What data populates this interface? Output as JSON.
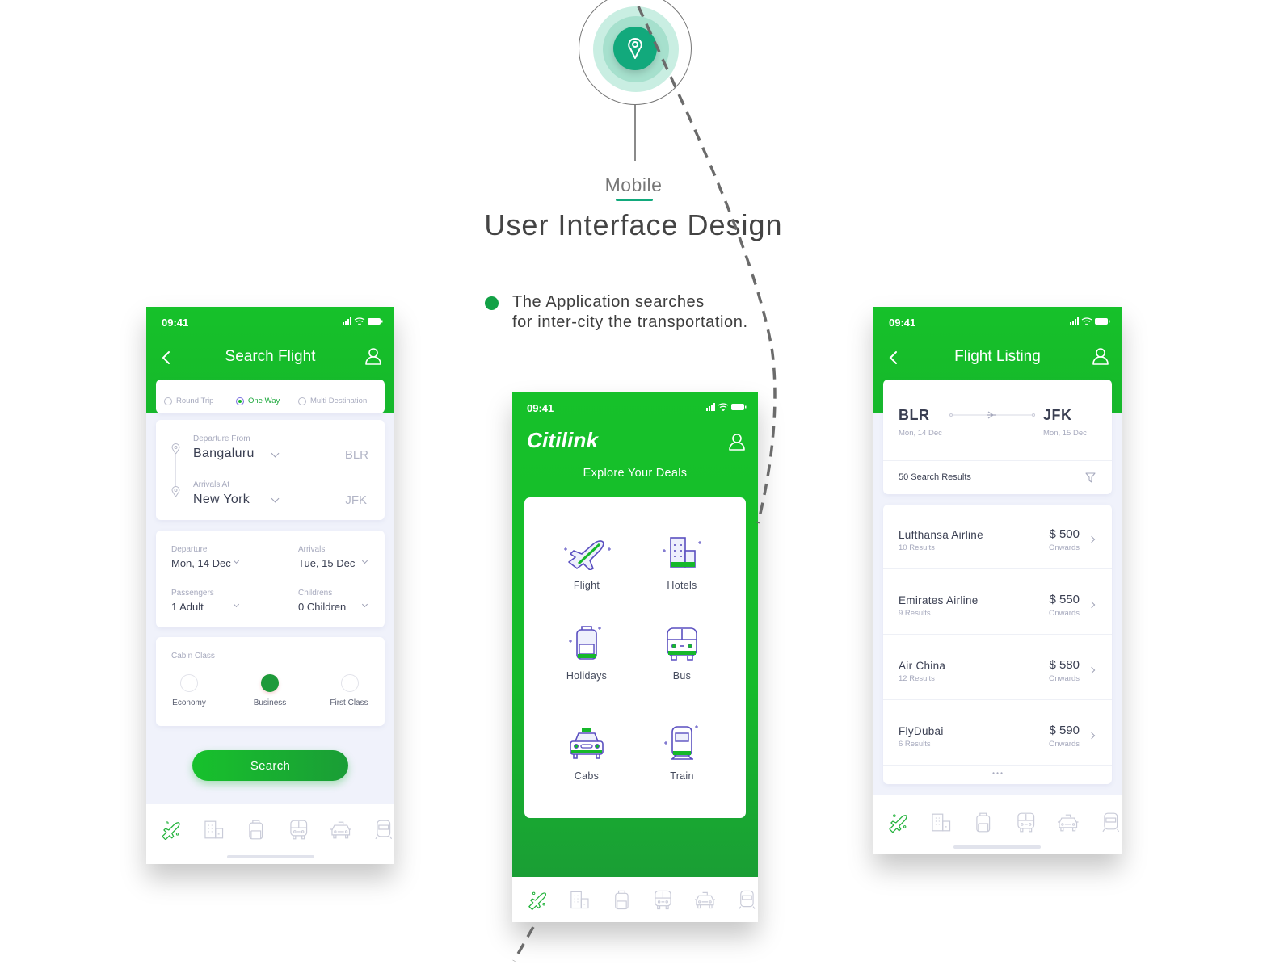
{
  "hero": {
    "subtitle": "Mobile",
    "title": "User Interface Design",
    "bullet_line1": "The Application searches",
    "bullet_line2": "for inter-city  the transportation.",
    "accent_color": "#12a97c",
    "icon": "location-pin-icon"
  },
  "brand_green": "#16c12a",
  "search_flight": {
    "status_time": "09:41",
    "title": "Search Flight",
    "trip_types": [
      {
        "label": "Round Trip",
        "selected": false
      },
      {
        "label": "One Way",
        "selected": true
      },
      {
        "label": "Multi Destination",
        "selected": false
      }
    ],
    "departure_from_label": "Departure From",
    "departure_city": "Bangaluru",
    "departure_code": "BLR",
    "arrivals_at_label": "Arrivals At",
    "arrival_city": "New York",
    "arrival_code": "JFK",
    "departure_label": "Departure",
    "departure_date": "Mon, 14 Dec",
    "arrivals_label": "Arrivals",
    "arrival_date": "Tue, 15 Dec",
    "passengers_label": "Passengers",
    "passengers_value": "1 Adult",
    "childrens_label": "Childrens",
    "childrens_value": "0 Children",
    "cabin_class_label": "Cabin Class",
    "cabin_options": [
      {
        "label": "Economy",
        "selected": false
      },
      {
        "label": "Business",
        "selected": true
      },
      {
        "label": "First Class",
        "selected": false
      }
    ],
    "search_button": "Search"
  },
  "explore": {
    "status_time": "09:41",
    "brand": "Citilink",
    "subtitle": "Explore Your Deals",
    "deals": [
      {
        "label": "Flight",
        "icon": "airplane-icon"
      },
      {
        "label": "Hotels",
        "icon": "hotel-icon"
      },
      {
        "label": "Holidays",
        "icon": "backpack-icon"
      },
      {
        "label": "Bus",
        "icon": "bus-icon"
      },
      {
        "label": "Cabs",
        "icon": "taxi-icon"
      },
      {
        "label": "Train",
        "icon": "train-icon"
      }
    ]
  },
  "flight_listing": {
    "status_time": "09:41",
    "title": "Flight Listing",
    "from_code": "BLR",
    "from_date": "Mon, 14 Dec",
    "to_code": "JFK",
    "to_date": "Mon, 15 Dec",
    "results_count": "50 Search Results",
    "results": [
      {
        "airline": "Lufthansa Airline",
        "count": "10 Results",
        "price": "$ 500",
        "note": "Onwards"
      },
      {
        "airline": "Emirates Airline",
        "count": "9 Results",
        "price": "$ 550",
        "note": "Onwards"
      },
      {
        "airline": "Air China",
        "count": "12 Results",
        "price": "$ 580",
        "note": "Onwards"
      },
      {
        "airline": "FlyDubai",
        "count": "6 Results",
        "price": "$ 590",
        "note": "Onwards"
      }
    ],
    "more": "• • •"
  },
  "tabbar": [
    "Flight",
    "Hotels",
    "Holidays",
    "Bus",
    "Cabs",
    "Train"
  ]
}
